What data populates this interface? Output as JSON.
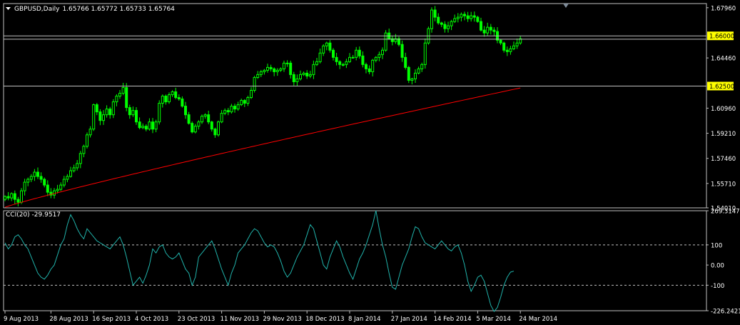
{
  "colors": {
    "background": "#000000",
    "frame": "#c0c0c0",
    "bull_candle": "#00ff00",
    "bear_candle": "#00ff00",
    "moving_average": "#ff0000",
    "cci_line": "#20b2aa",
    "level_line": "#c0c0c0",
    "price_label_bg": "#ffff00",
    "price_label_text": "#000000",
    "text": "#ffffff"
  },
  "header": {
    "symbol_label": "GBPUSD,Daily",
    "ohlc_text": "1.65766 1.65772 1.65733 1.65764",
    "collapse_icon": "triangle-down-icon"
  },
  "indicator_header": {
    "label": "CCI(20) -29.9517"
  },
  "chart_data": [
    {
      "type": "candlestick",
      "title": "GBPUSD,Daily",
      "ylim": [
        1.5401,
        1.6825
      ],
      "price_ticks": [
        "1.67960",
        "1.64460",
        "1.60960",
        "1.59210",
        "1.57460",
        "1.55710",
        "1.54010"
      ],
      "price_tick_values": [
        1.6796,
        1.6446,
        1.6096,
        1.5921,
        1.5746,
        1.5571,
        1.5401
      ],
      "horizontal_levels": [
        {
          "value": 1.66,
          "label": "1.66000"
        },
        {
          "value": 1.625,
          "label": "1.62500"
        }
      ],
      "date_ticks": [
        "9 Aug 2013",
        "28 Aug 2013",
        "16 Sep 2013",
        "4 Oct 2013",
        "23 Oct 2013",
        "11 Nov 2013",
        "29 Nov 2013",
        "18 Dec 2013",
        "8 Jan 2014",
        "27 Jan 2014",
        "14 Feb 2014",
        "5 Mar 2014",
        "24 Mar 2014"
      ],
      "date_tick_bar_index": [
        0,
        14,
        27,
        40,
        53,
        66,
        79,
        92,
        105,
        118,
        131,
        144,
        157
      ],
      "close": [
        1.548,
        1.547,
        1.55,
        1.546,
        1.544,
        1.552,
        1.558,
        1.56,
        1.562,
        1.565,
        1.562,
        1.56,
        1.556,
        1.551,
        1.549,
        1.552,
        1.553,
        1.556,
        1.56,
        1.562,
        1.566,
        1.568,
        1.571,
        1.578,
        1.583,
        1.591,
        1.595,
        1.612,
        1.607,
        1.601,
        1.605,
        1.609,
        1.605,
        1.614,
        1.618,
        1.62,
        1.624,
        1.61,
        1.605,
        1.608,
        1.6,
        1.596,
        1.597,
        1.595,
        1.6,
        1.595,
        1.6,
        1.613,
        1.618,
        1.614,
        1.619,
        1.621,
        1.617,
        1.616,
        1.611,
        1.605,
        1.599,
        1.593,
        1.597,
        1.6,
        1.604,
        1.605,
        1.6,
        1.595,
        1.591,
        1.6,
        1.606,
        1.608,
        1.607,
        1.611,
        1.609,
        1.612,
        1.615,
        1.613,
        1.617,
        1.622,
        1.631,
        1.633,
        1.635,
        1.636,
        1.638,
        1.637,
        1.635,
        1.636,
        1.637,
        1.641,
        1.641,
        1.633,
        1.628,
        1.63,
        1.633,
        1.634,
        1.632,
        1.633,
        1.64,
        1.642,
        1.648,
        1.653,
        1.655,
        1.65,
        1.645,
        1.642,
        1.64,
        1.64,
        1.642,
        1.645,
        1.645,
        1.65,
        1.646,
        1.64,
        1.637,
        1.635,
        1.643,
        1.645,
        1.647,
        1.65,
        1.662,
        1.658,
        1.656,
        1.658,
        1.654,
        1.645,
        1.638,
        1.629,
        1.63,
        1.634,
        1.637,
        1.64,
        1.655,
        1.665,
        1.678,
        1.673,
        1.669,
        1.668,
        1.665,
        1.667,
        1.67,
        1.672,
        1.673,
        1.675,
        1.674,
        1.672,
        1.674,
        1.673,
        1.67,
        1.664,
        1.662,
        1.666,
        1.664,
        1.663,
        1.657,
        1.655,
        1.65,
        1.649,
        1.651,
        1.653,
        1.655,
        1.658
      ],
      "ma_start": 1.5405,
      "ma_end": 1.6237,
      "current_close": 1.65764
    },
    {
      "type": "line",
      "title": "CCI(20) -29.9517",
      "ylim": [
        -226.2421,
        269.3147
      ],
      "value_ticks": [
        "269.3147",
        "100",
        "0.00",
        "-100",
        "-226.2421"
      ],
      "value_tick_values": [
        269.3147,
        100,
        0,
        -100,
        -226.2421
      ],
      "dashed_levels": [
        100,
        -100
      ],
      "values": [
        110,
        80,
        100,
        140,
        150,
        130,
        100,
        80,
        40,
        0,
        -40,
        -60,
        -70,
        -50,
        -20,
        0,
        50,
        100,
        130,
        200,
        250,
        220,
        180,
        150,
        130,
        180,
        160,
        140,
        120,
        110,
        100,
        90,
        80,
        100,
        120,
        140,
        100,
        40,
        -30,
        -100,
        -80,
        -60,
        -90,
        -50,
        0,
        80,
        60,
        90,
        100,
        60,
        40,
        30,
        40,
        60,
        20,
        -20,
        -40,
        -100,
        -60,
        40,
        60,
        80,
        100,
        120,
        80,
        30,
        -20,
        -60,
        -100,
        -40,
        0,
        60,
        80,
        100,
        130,
        160,
        180,
        170,
        140,
        110,
        90,
        100,
        90,
        60,
        20,
        -30,
        -60,
        -40,
        0,
        40,
        70,
        100,
        150,
        200,
        180,
        120,
        60,
        0,
        -20,
        40,
        80,
        120,
        90,
        40,
        0,
        -40,
        -70,
        -20,
        30,
        60,
        100,
        150,
        200,
        270,
        180,
        100,
        40,
        -40,
        -110,
        -120,
        -60,
        0,
        40,
        80,
        140,
        190,
        180,
        140,
        110,
        100,
        90,
        80,
        100,
        120,
        100,
        80,
        70,
        90,
        100,
        60,
        0,
        -80,
        -130,
        -100,
        -60,
        -50,
        -80,
        -140,
        -200,
        -230,
        -210,
        -160,
        -100,
        -60,
        -35,
        -29.95
      ]
    }
  ]
}
